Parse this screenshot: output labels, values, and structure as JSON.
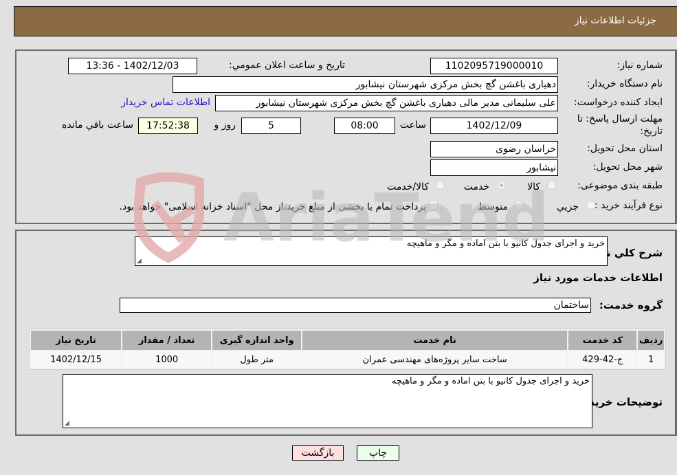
{
  "header": {
    "title": "جزئیات اطلاعات نیاز"
  },
  "fields": {
    "need_number_label": "شماره نیاز:",
    "need_number": "1102095719000010",
    "announce_label": "تاريخ و ساعت اعلان عمومي:",
    "announce_value": "1402/12/03 - 13:36",
    "buyer_org_label": "نام دستگاه خریدار:",
    "buyer_org": "دهیاری باغشن گچ بخش مرکزی شهرستان نیشابور",
    "creator_label": "ایجاد کننده درخواست:",
    "creator": "علی سلیمانی مدیر مالی دهیاری باغشن گچ بخش مرکزی شهرستان نیشابور",
    "contact_link": "اطلاعات تماس خریدار",
    "deadline_label_1": "مهلت ارسال پاسخ: تا",
    "deadline_label_2": "تاریخ:",
    "deadline_date": "1402/12/09",
    "time_label": "ساعت",
    "deadline_time": "08:00",
    "days_value": "5",
    "days_label": "روز و",
    "remaining_time": "17:52:38",
    "remaining_label": "ساعت باقي مانده",
    "province_label": "استان محل تحویل:",
    "province": "خراسان رضوی",
    "city_label": "شهر محل تحویل:",
    "city": "نیشابور",
    "category_label": "طبقه بندی موضوعی:",
    "category_options": [
      {
        "label": "کالا",
        "checked": false
      },
      {
        "label": "خدمت",
        "checked": true
      },
      {
        "label": "کالا/خدمت",
        "checked": false
      }
    ],
    "process_label": "نوع فرآیند خرید :",
    "process_options": [
      {
        "label": "جزيي",
        "checked": false
      },
      {
        "label": "متوسط",
        "checked": false
      }
    ],
    "treasury_note": "پرداخت تمام یا بخشی از مبلغ خرید،از محل \"اسناد خزانه اسلامی\" خواهد بود."
  },
  "details": {
    "description_label": "شرح كلي نياز:",
    "description": "خرید و اجرای جدول کانیو با بتن اماده  و مگر و ماهیچه",
    "services_heading": "اطلاعات خدمات مورد نیاز",
    "service_group_label": "گروه خدمت:",
    "service_group": "ساختمان",
    "table": {
      "headers": [
        "ردیف",
        "کد خدمت",
        "نام خدمت",
        "واحد اندازه گیری",
        "تعداد / مقدار",
        "تاریخ نیاز"
      ],
      "rows": [
        [
          "1",
          "ج-42-429",
          "ساخت سایر پروژه‌های مهندسی عمران",
          "متر طول",
          "1000",
          "1402/12/15"
        ]
      ]
    },
    "buyer_notes_label": "توضیحات خریدار:",
    "buyer_notes": "خرید و اجرای جدول کانیو با بتن اماده  و مگر و ماهیچه"
  },
  "buttons": {
    "print": "چاپ",
    "back": "بازگشت"
  },
  "watermark": {
    "text": "AriaTender.neT"
  }
}
